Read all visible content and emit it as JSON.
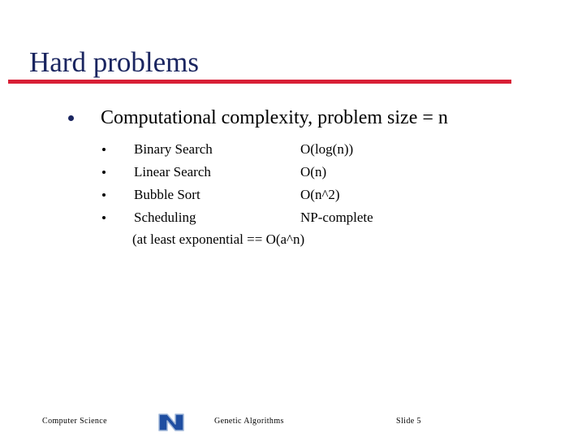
{
  "slide": {
    "title": "Hard problems",
    "accent_color": "#d81f36",
    "title_color": "#1a2560",
    "bullet": {
      "text": "Computational complexity, problem size = n"
    },
    "rows": [
      {
        "name": "Binary Search",
        "complexity": "O(log(n))"
      },
      {
        "name": "Linear Search",
        "complexity": "O(n)"
      },
      {
        "name": "Bubble Sort",
        "complexity": "O(n^2)"
      },
      {
        "name": "Scheduling",
        "complexity": "NP-complete"
      }
    ],
    "note": "(at least exponential == O(a^n)"
  },
  "footer": {
    "left": "Computer Science",
    "middle": "Genetic Algorithms",
    "right": "Slide  5",
    "logo_letter": "N",
    "logo_color": "#1f4ea1"
  }
}
